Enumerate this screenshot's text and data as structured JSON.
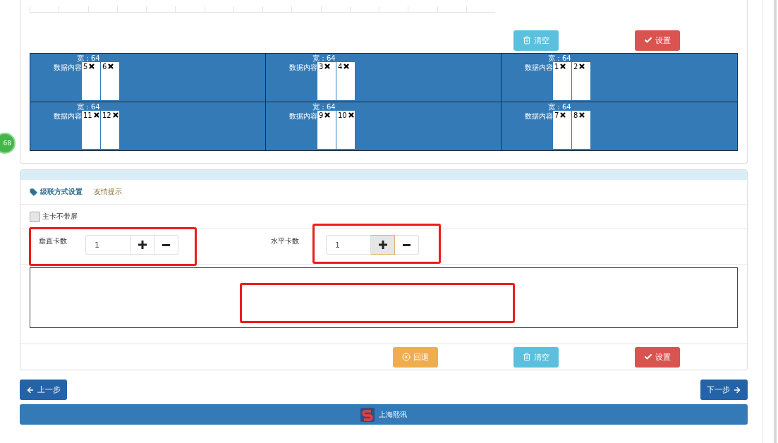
{
  "badge": {
    "text": "68"
  },
  "top_panel": {
    "clear_button": "清空",
    "set_button": "设置",
    "grid": [
      [
        {
          "width_label": "宽：64",
          "content_label": "数据内容",
          "slots": [
            "5",
            "6"
          ]
        },
        {
          "width_label": "宽：64",
          "content_label": "数据内容",
          "slots": [
            "3",
            "4"
          ]
        },
        {
          "width_label": "宽：64",
          "content_label": "数据内容",
          "slots": [
            "1",
            "2"
          ]
        }
      ],
      [
        {
          "width_label": "宽：64",
          "content_label": "数据内容",
          "slots": [
            "11",
            "12"
          ]
        },
        {
          "width_label": "宽：64",
          "content_label": "数据内容",
          "slots": [
            "9",
            "10"
          ]
        },
        {
          "width_label": "宽：64",
          "content_label": "数据内容",
          "slots": [
            "7",
            "8"
          ]
        }
      ]
    ]
  },
  "cascade_panel": {
    "tabs": [
      {
        "label": "级联方式设置",
        "selected": true
      },
      {
        "label": "友情提示",
        "selected": false
      }
    ],
    "checkbox": {
      "label": "主卡不带屏",
      "checked": false
    },
    "spinners": [
      {
        "label": "垂直卡数",
        "value": "1",
        "plus_active": false
      },
      {
        "label": "水平卡数",
        "value": "1",
        "plus_active": true
      }
    ],
    "annotations": [
      {
        "kind": "frame"
      },
      {
        "kind": "frame"
      },
      {
        "kind": "frame"
      }
    ],
    "buttons": [
      {
        "kind": "back",
        "label": "回退"
      },
      {
        "kind": "clear",
        "label": "清空"
      },
      {
        "kind": "set",
        "label": "设置"
      }
    ]
  },
  "nav": {
    "prev": "上一步",
    "next": "下一步"
  },
  "footer": {
    "brand": "上海熙讯"
  }
}
